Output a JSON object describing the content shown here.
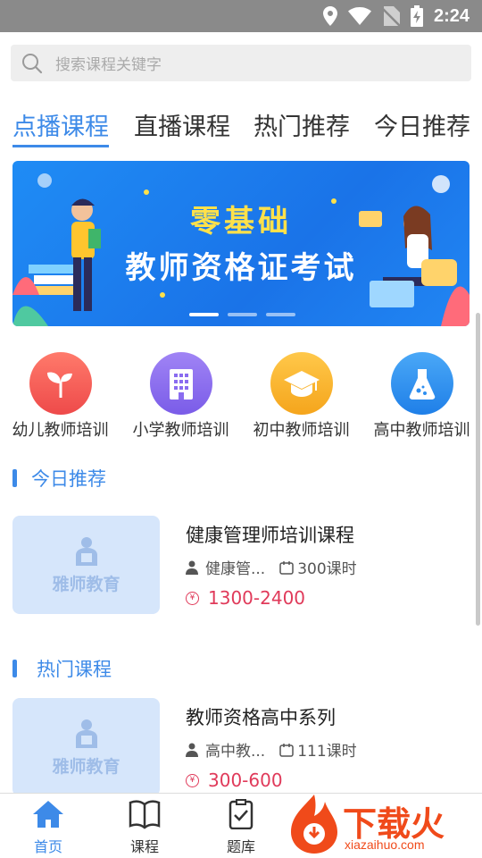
{
  "status_bar": {
    "time": "2:24"
  },
  "search": {
    "placeholder": "搜索课程关键字"
  },
  "tabs": [
    {
      "label": "点播课程",
      "active": true
    },
    {
      "label": "直播课程",
      "active": false
    },
    {
      "label": "热门推荐",
      "active": false
    },
    {
      "label": "今日推荐",
      "active": false
    }
  ],
  "banner": {
    "line1": "零基础",
    "line2": "教师资格证考试",
    "slides": 3,
    "active_slide": 1
  },
  "categories": [
    {
      "label": "幼儿教师培训",
      "icon": "sprout-icon",
      "color": "#f25b5b"
    },
    {
      "label": "小学教师培训",
      "icon": "building-icon",
      "color": "#8a6cf0"
    },
    {
      "label": "初中教师培训",
      "icon": "graduation-cap-icon",
      "color": "#f7b52b"
    },
    {
      "label": "高中教师培训",
      "icon": "flask-icon",
      "color": "#2c8ef0"
    }
  ],
  "sections": {
    "today": {
      "title": "今日推荐",
      "course": {
        "thumb_brand": "雅师教育",
        "title": "健康管理师培训课程",
        "teacher": "健康管...",
        "hours": "300课时",
        "price_symbol": "¥",
        "price": "1300-2400"
      }
    },
    "hot": {
      "title": "热门课程",
      "course": {
        "thumb_brand": "雅师教育",
        "title": "教师资格高中系列",
        "teacher": "高中教...",
        "hours": "111课时",
        "price_symbol": "¥",
        "price": "300-600"
      }
    }
  },
  "bottom_nav": [
    {
      "label": "首页",
      "icon": "home-icon",
      "active": true
    },
    {
      "label": "课程",
      "icon": "book-icon",
      "active": false
    },
    {
      "label": "题库",
      "icon": "checklist-icon",
      "active": false
    }
  ],
  "watermark": {
    "text": "下载火",
    "url": "xiazaihuo.com"
  },
  "colors": {
    "accent": "#3d8ae8",
    "price": "#e03a5a",
    "statusbar": "#8a8a8a"
  }
}
